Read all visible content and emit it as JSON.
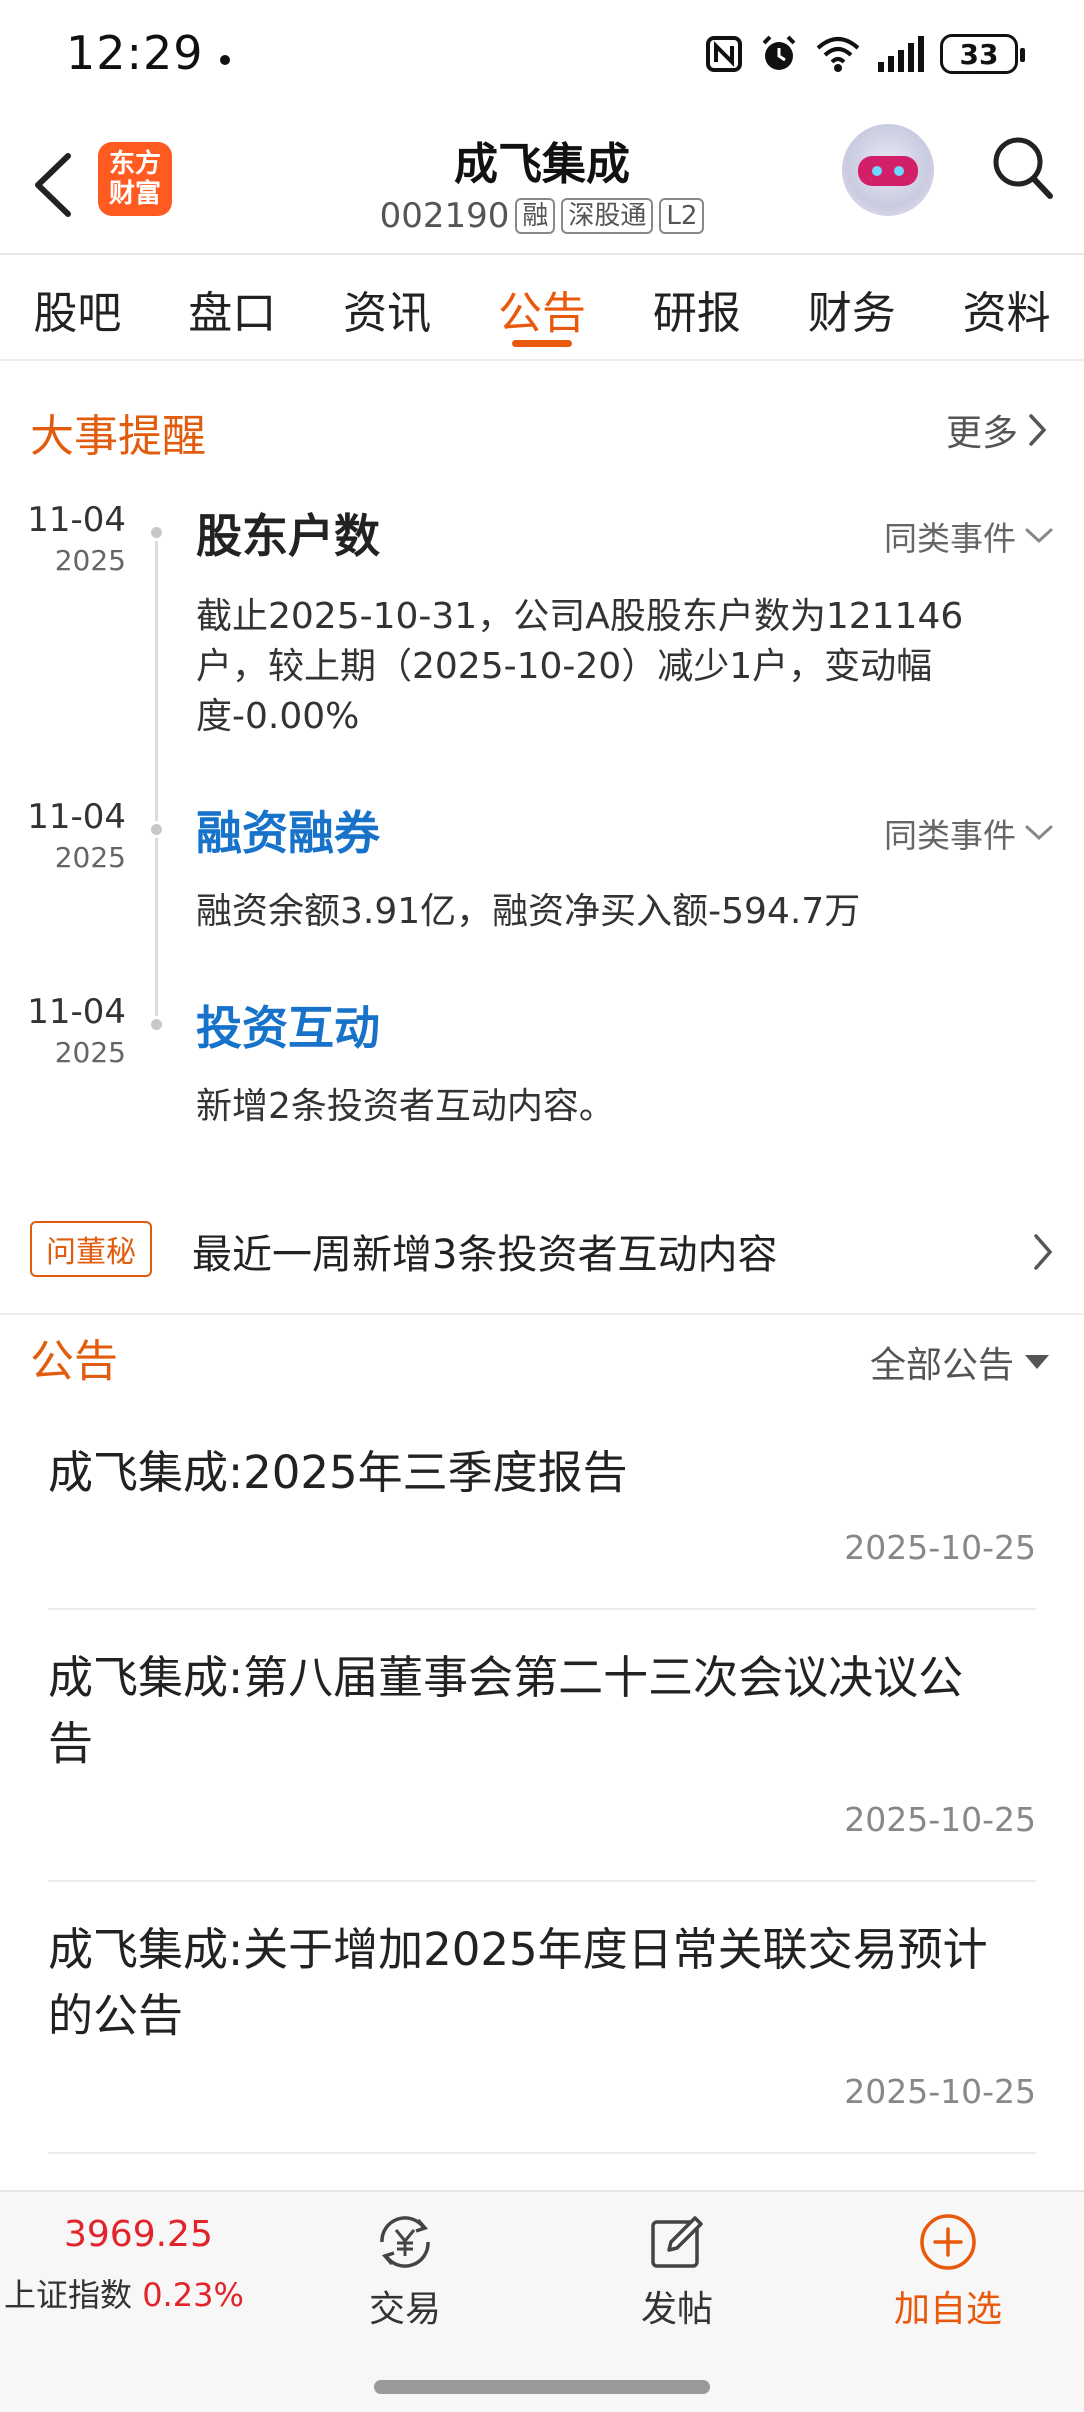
{
  "status_bar": {
    "time": "12:29",
    "battery": "33"
  },
  "header": {
    "logo_line1": "东方",
    "logo_line2": "财富",
    "stock_name": "成飞集成",
    "stock_code": "002190",
    "tags": [
      "融",
      "深股通",
      "L2"
    ]
  },
  "tabs": [
    {
      "label": "股吧",
      "active": false
    },
    {
      "label": "盘口",
      "active": false
    },
    {
      "label": "资讯",
      "active": false
    },
    {
      "label": "公告",
      "active": true
    },
    {
      "label": "研报",
      "active": false
    },
    {
      "label": "财务",
      "active": false
    },
    {
      "label": "资料",
      "active": false
    }
  ],
  "events_section": {
    "title": "大事提醒",
    "more_label": "更多",
    "similar_label": "同类事件",
    "events": [
      {
        "date": "11-04",
        "year": "2025",
        "title": "股东户数",
        "desc_lines": [
          "截止2025-10-31，公司A股股东户数为121146",
          "户，较上期（2025-10-20）减少1户，变动幅",
          "度-0.00%"
        ]
      },
      {
        "date": "11-04",
        "year": "2025",
        "title": "融资融券",
        "desc_lines": [
          "融资余额3.91亿，融资净买入额-594.7万"
        ]
      },
      {
        "date": "11-04",
        "year": "2025",
        "title": "投资互动",
        "desc_lines": [
          "新增2条投资者互动内容。"
        ]
      }
    ]
  },
  "wendongmi": {
    "badge": "问董秘",
    "text": "最近一周新增3条投资者互动内容"
  },
  "announcements": {
    "title": "公告",
    "filter_label": "全部公告",
    "items": [
      {
        "title_lines": [
          "成飞集成:2025年三季度报告"
        ],
        "date": "2025-10-25"
      },
      {
        "title_lines": [
          "成飞集成:第八届董事会第二十三次会议决议公",
          "告"
        ],
        "date": "2025-10-25"
      },
      {
        "title_lines": [
          "成飞集成:关于增加2025年度日常关联交易预计",
          "的公告"
        ],
        "date": "2025-10-25"
      }
    ]
  },
  "bottom_bar": {
    "index_value": "3969.25",
    "index_name": "上证指数",
    "index_change": "0.23%",
    "trade_label": "交易",
    "post_label": "发帖",
    "add_label": "加自选"
  },
  "colors": {
    "accent": "#e8590c",
    "blue_title": "#1772c9",
    "up_red": "#e0242a"
  }
}
